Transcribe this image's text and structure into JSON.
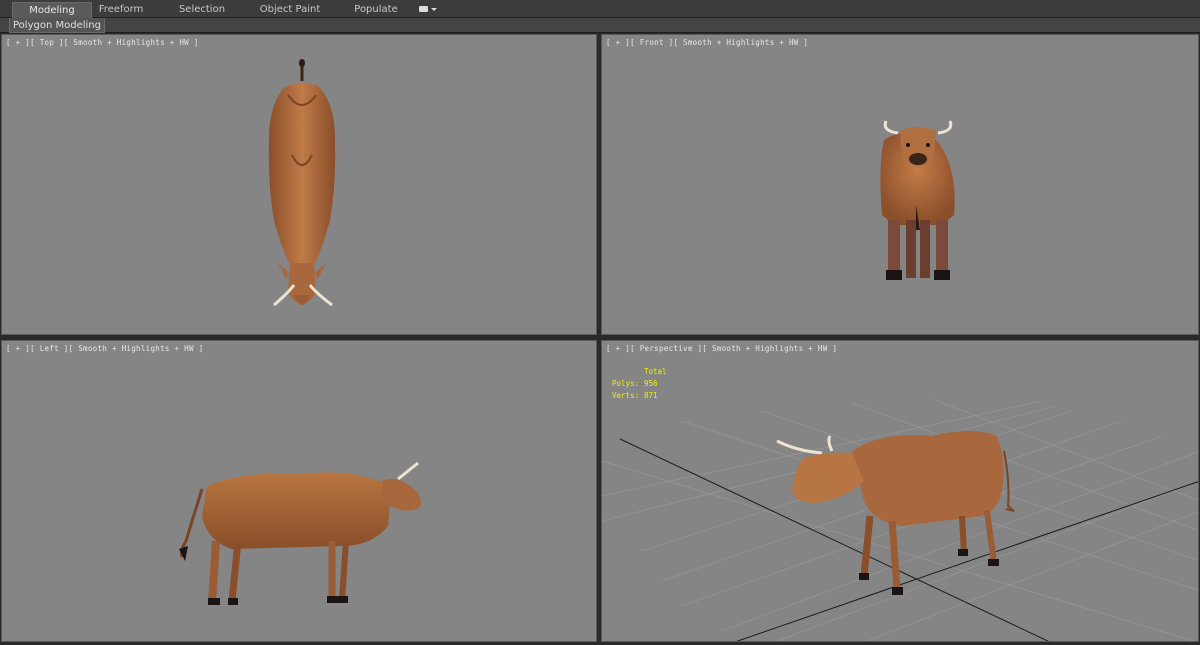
{
  "ribbon": {
    "tabs": [
      {
        "label": "Modeling",
        "active": true
      },
      {
        "label": "Freeform",
        "active": false
      },
      {
        "label": "Selection",
        "active": false
      },
      {
        "label": "Object Paint",
        "active": false
      },
      {
        "label": "Populate",
        "active": false
      }
    ],
    "subtab": "Polygon Modeling",
    "extra_icon": "camera-dropdown-icon"
  },
  "viewports": {
    "top": {
      "label": "[ + ][ Top ][ Smooth + Highlights + HW ]"
    },
    "front": {
      "label": "[ + ][ Front ][ Smooth + Highlights + HW ]"
    },
    "left": {
      "label": "[ + ][ Left ][ Smooth + Highlights + HW ]"
    },
    "perspective": {
      "label": "[ + ][ Perspective ][ Smooth + Highlights + HW ]",
      "stats": {
        "header": "Total",
        "polys_label": "Polys:",
        "polys_value": "956",
        "verts_label": "Verts:",
        "verts_value": "871"
      }
    }
  },
  "colors": {
    "viewport_bg": "#858585",
    "cow_body": "#a9683c",
    "cow_shadow": "#7a4526",
    "horn": "#e8e2d4",
    "hoof": "#1a1414",
    "stats_text": "#f0f000"
  }
}
